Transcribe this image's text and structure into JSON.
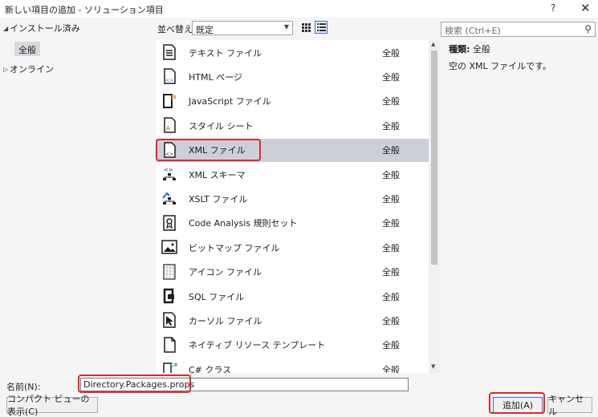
{
  "window": {
    "title": "新しい項目の追加 - ソリューション項目",
    "help": "?",
    "close": "✕"
  },
  "tree": {
    "installed_label": "インストール済み",
    "installed_child": "全般",
    "online_label": "オンライン"
  },
  "toolbar": {
    "sort_label": "並べ替え:",
    "sort_value": "既定"
  },
  "items": [
    {
      "name": "テキスト ファイル",
      "category": "全般",
      "icon": "text-file-icon"
    },
    {
      "name": "HTML ページ",
      "category": "全般",
      "icon": "html-page-icon"
    },
    {
      "name": "JavaScript ファイル",
      "category": "全般",
      "icon": "javascript-file-icon"
    },
    {
      "name": "スタイル シート",
      "category": "全般",
      "icon": "stylesheet-icon"
    },
    {
      "name": "XML ファイル",
      "category": "全般",
      "icon": "xml-file-icon",
      "selected": true
    },
    {
      "name": "XML スキーマ",
      "category": "全般",
      "icon": "xml-schema-icon"
    },
    {
      "name": "XSLT ファイル",
      "category": "全般",
      "icon": "xslt-file-icon"
    },
    {
      "name": "Code Analysis 規則セット",
      "category": "全般",
      "icon": "ruleset-icon"
    },
    {
      "name": "ビットマップ ファイル",
      "category": "全般",
      "icon": "bitmap-file-icon"
    },
    {
      "name": "アイコン ファイル",
      "category": "全般",
      "icon": "icon-file-icon"
    },
    {
      "name": "SQL ファイル",
      "category": "全般",
      "icon": "sql-file-icon"
    },
    {
      "name": "カーソル ファイル",
      "category": "全般",
      "icon": "cursor-file-icon"
    },
    {
      "name": "ネイティブ リソース テンプレート",
      "category": "全般",
      "icon": "native-resource-template-icon"
    },
    {
      "name": "C# クラス",
      "category": "全般",
      "icon": "csharp-class-icon"
    }
  ],
  "search": {
    "placeholder": "検索 (Ctrl+E)"
  },
  "detail": {
    "type_label": "種類:",
    "type_value": "全般",
    "description": "空の XML ファイルです。"
  },
  "bottom": {
    "name_label": "名前(N):",
    "name_value": "Directory.Packages.props",
    "compact_button": "コンパクト ビューの表示(C)",
    "add_button": "追加(A)",
    "cancel_button": "キャンセル"
  },
  "colors": {
    "highlight_red": "#e0282e",
    "selected_bg": "#ccced8",
    "accent_blue": "#3a6fc4"
  }
}
